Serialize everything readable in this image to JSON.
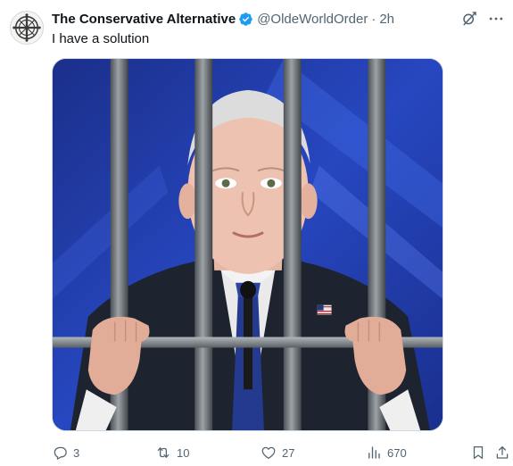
{
  "tweet": {
    "display_name": "The Conservative Alternative",
    "handle": "@OldeWorldOrder",
    "separator": "·",
    "time": "2h",
    "text": "I have a solution",
    "verified": true
  },
  "icons": {
    "avatar": "avatar-emblem",
    "verified": "verified-badge-icon",
    "grok": "grok-icon",
    "more": "more-icon",
    "reply": "reply-icon",
    "repost": "repost-icon",
    "like": "like-icon",
    "views": "views-icon",
    "bookmark": "bookmark-icon",
    "share": "share-icon"
  },
  "colors": {
    "accent": "#1d9bf0",
    "secondary_text": "#536471",
    "primary_text": "#0f1419"
  },
  "actions": {
    "replies": "3",
    "reposts": "10",
    "likes": "27",
    "views": "670"
  }
}
